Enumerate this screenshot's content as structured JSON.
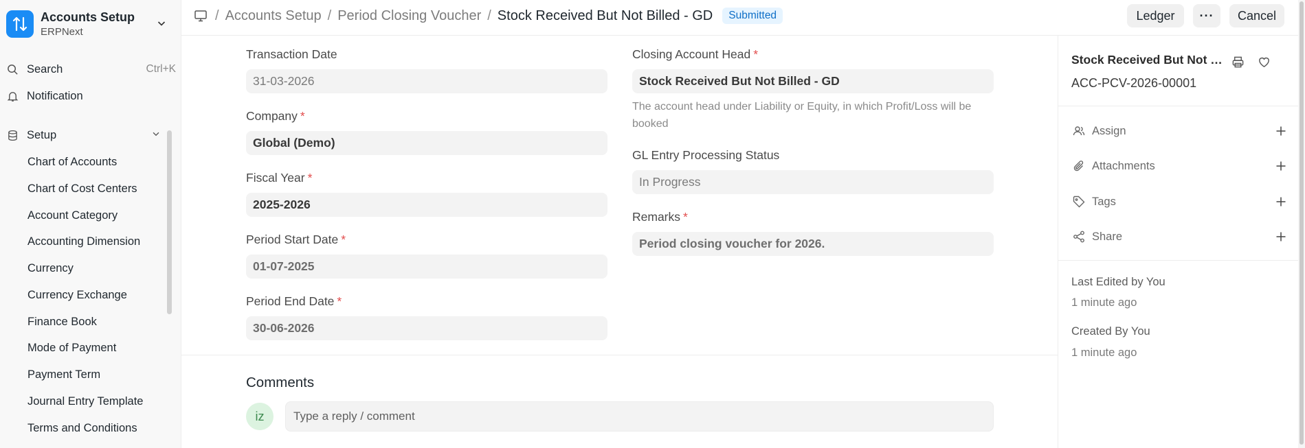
{
  "app": {
    "title": "Accounts Setup",
    "subtitle": "ERPNext",
    "accent": "#1a8cf5"
  },
  "sidebar": {
    "search_label": "Search",
    "search_shortcut": "Ctrl+K",
    "notification_label": "Notification",
    "section_label": "Setup",
    "items": [
      {
        "label": "Chart of Accounts"
      },
      {
        "label": "Chart of Cost Centers"
      },
      {
        "label": "Account Category"
      },
      {
        "label": "Accounting Dimension"
      },
      {
        "label": "Currency"
      },
      {
        "label": "Currency Exchange"
      },
      {
        "label": "Finance Book"
      },
      {
        "label": "Mode of Payment"
      },
      {
        "label": "Payment Term"
      },
      {
        "label": "Journal Entry Template"
      },
      {
        "label": "Terms and Conditions"
      }
    ]
  },
  "breadcrumb": {
    "items": [
      "Accounts Setup",
      "Period Closing Voucher"
    ],
    "current": "Stock Received But Not Billed - GD",
    "status": "Submitted"
  },
  "actions": {
    "ledger": "Ledger",
    "more": "···",
    "cancel": "Cancel"
  },
  "form": {
    "transaction_date": {
      "label": "Transaction Date",
      "value": "31-03-2026"
    },
    "company": {
      "label": "Company",
      "value": "Global (Demo)"
    },
    "fiscal_year": {
      "label": "Fiscal Year",
      "value": "2025-2026"
    },
    "period_start_date": {
      "label": "Period Start Date",
      "value": "01-07-2025"
    },
    "period_end_date": {
      "label": "Period End Date",
      "value": "30-06-2026"
    },
    "closing_account_head": {
      "label": "Closing Account Head",
      "value": "Stock Received But Not Billed - GD",
      "help": "The account head under Liability or Equity, in which Profit/Loss will be booked"
    },
    "gl_status": {
      "label": "GL Entry Processing Status",
      "value": "In Progress"
    },
    "remarks": {
      "label": "Remarks",
      "value": "Period closing voucher for 2026."
    },
    "required_mark": "*"
  },
  "comments": {
    "title": "Comments",
    "avatar_initials": "iz",
    "placeholder": "Type a reply / comment"
  },
  "sidepanel": {
    "doc_title": "Stock Received But Not Billed - GD",
    "doc_id": "ACC-PCV-2026-00001",
    "assign": "Assign",
    "attachments": "Attachments",
    "tags": "Tags",
    "share": "Share",
    "last_edited": "Last Edited by You",
    "last_edited_time": "1 minute ago",
    "created": "Created By You",
    "created_time": "1 minute ago"
  }
}
